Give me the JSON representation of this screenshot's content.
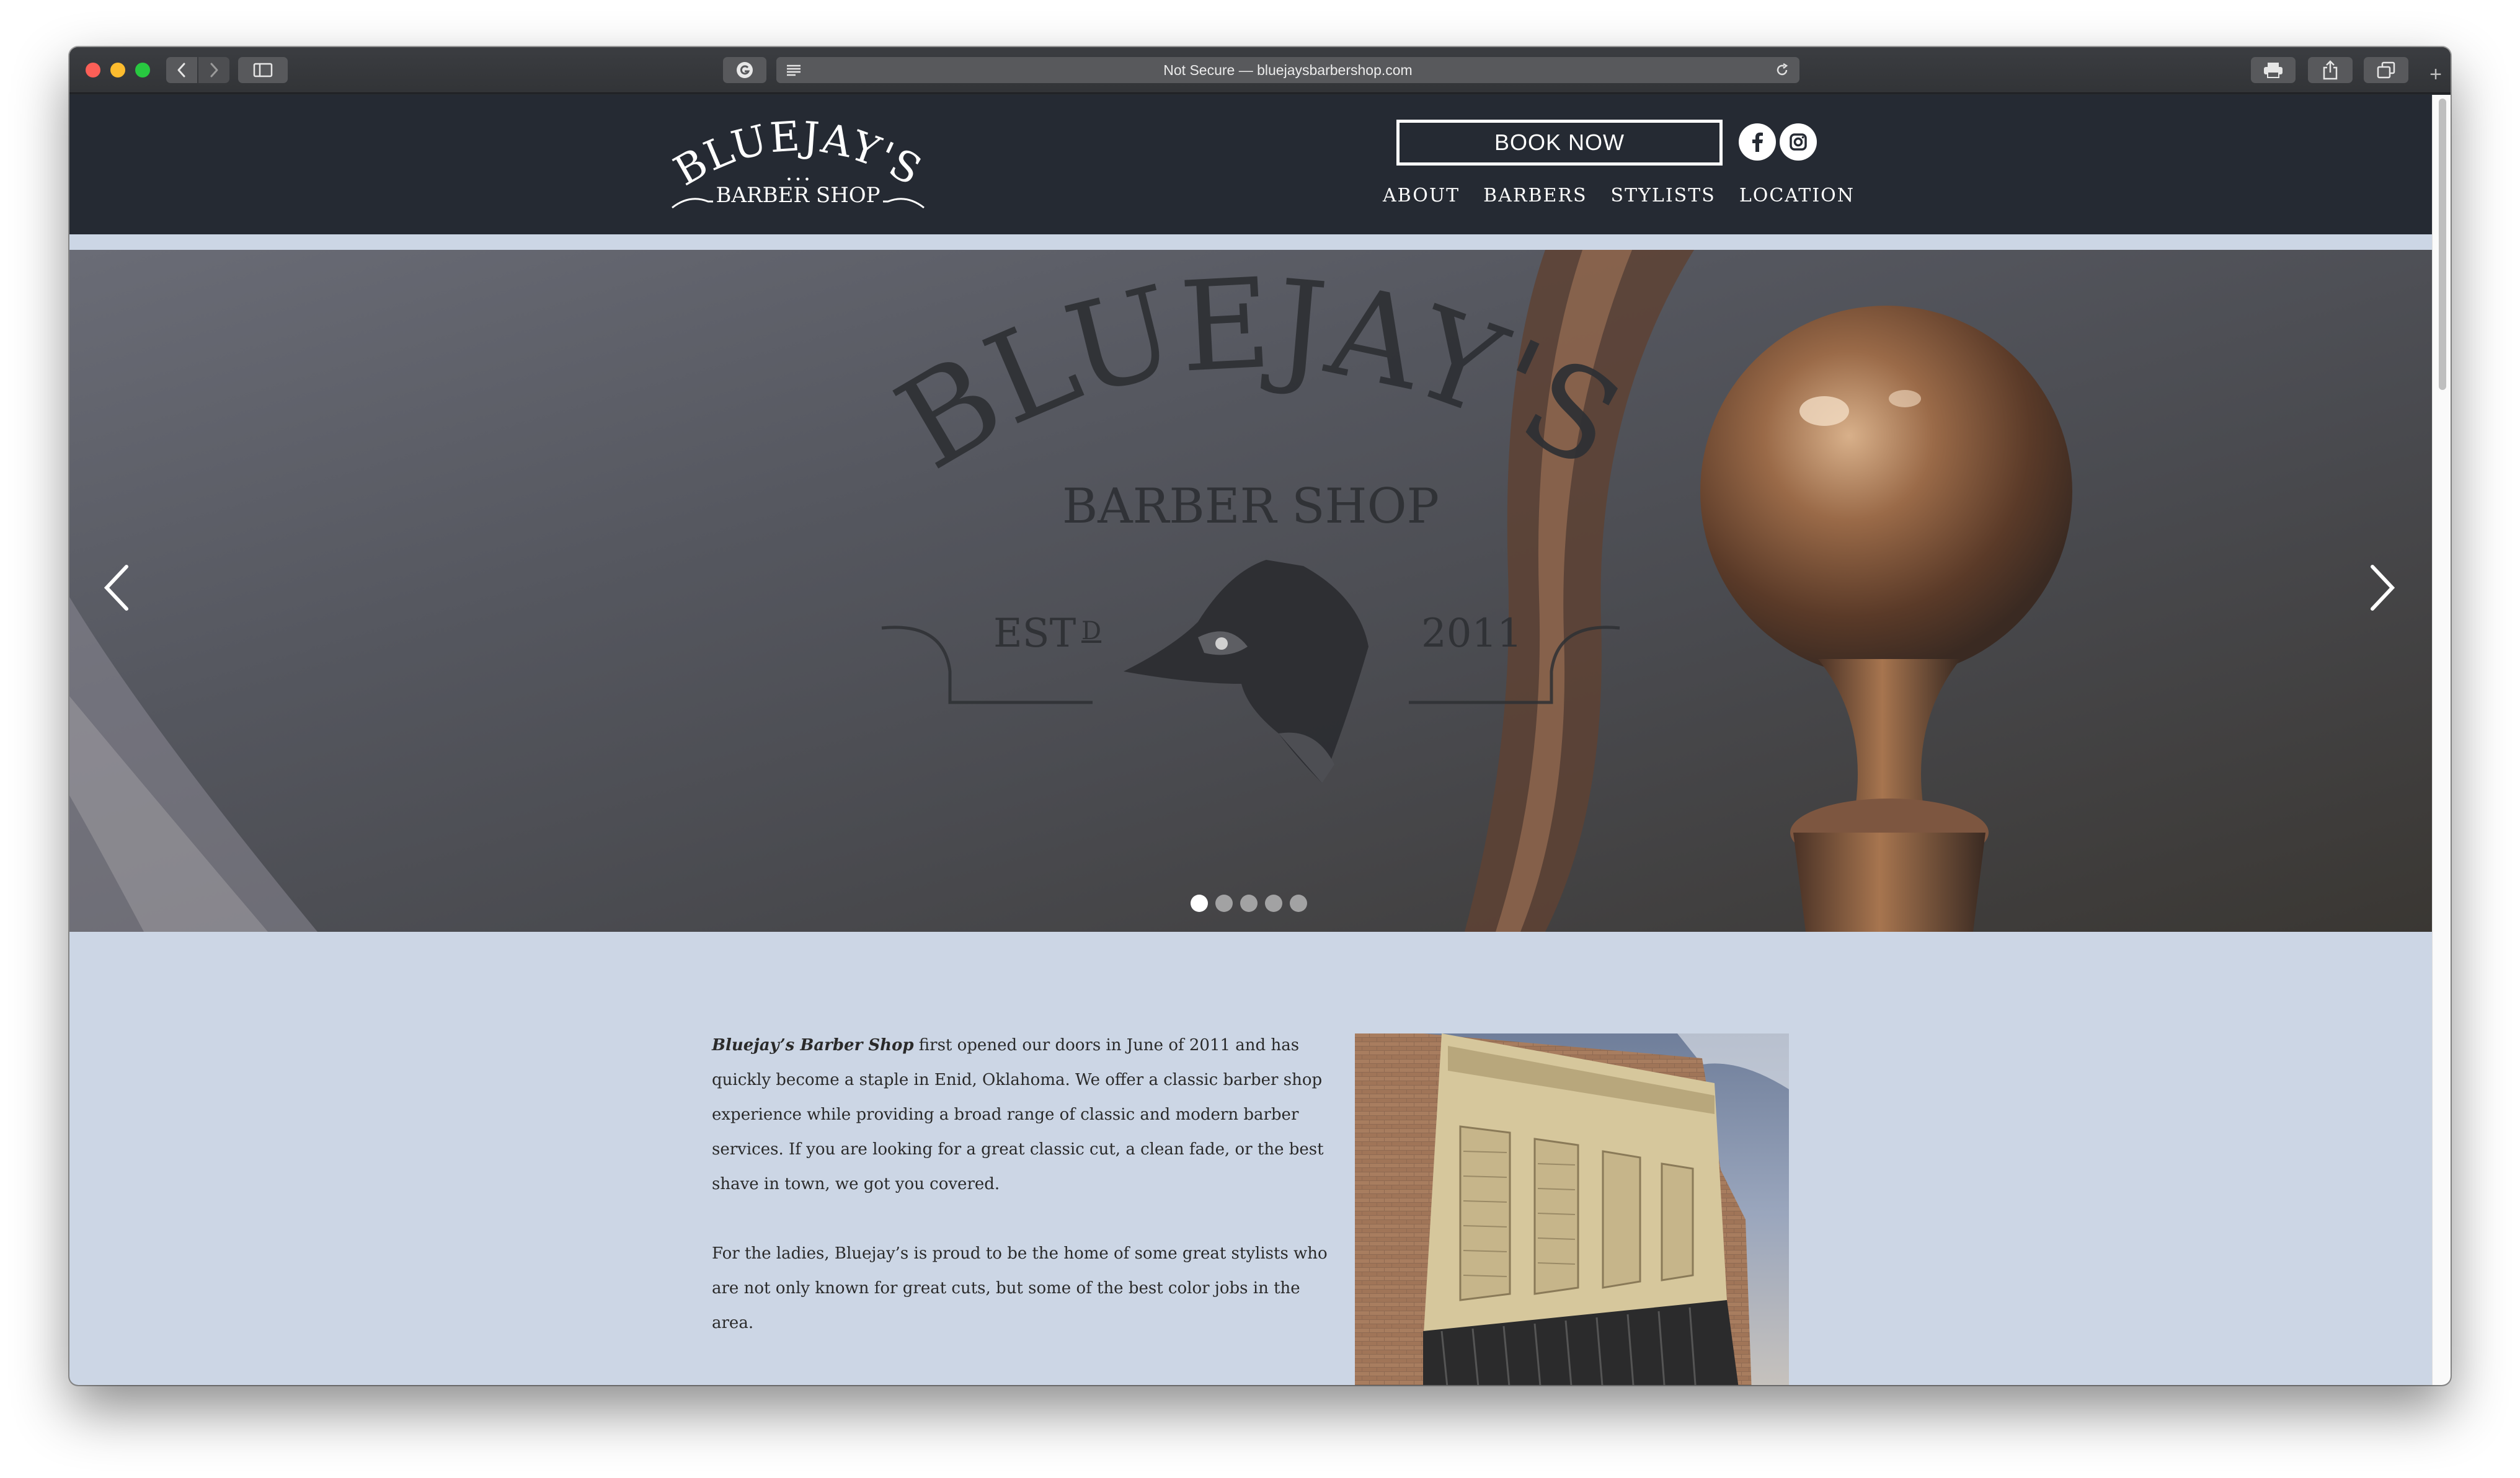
{
  "browser": {
    "address": "Not Secure — bluejaysbarbershop.com",
    "new_tab": "+"
  },
  "header": {
    "logo": {
      "name": "BLUEJAY'S",
      "sub": "BARBER SHOP",
      "dots": "• • •"
    },
    "book_now": "BOOK NOW",
    "nav": [
      "ABOUT",
      "BARBERS",
      "STYLISTS",
      "LOCATION"
    ]
  },
  "hero": {
    "logo_name": "BLUEJAY'S",
    "logo_sub": "BARBER SHOP",
    "estd": "EST",
    "estd_d": "D",
    "year": "2011",
    "slides": 5,
    "active_slide": 1
  },
  "intro": {
    "p1_em": "Bluejay’s Barber Shop",
    "p1_rest": " first opened our doors in June of 2011 and has quickly become a staple in Enid, Oklahoma. We offer a classic barber shop experience while providing a broad range of classic and modern barber services. If you are looking for a great classic cut, a clean fade, or the best shave in town, we got you covered.",
    "p2": "For the ladies, Bluejay’s is proud to be the home of some great stylists who are not only known for great cuts, but some of the best color jobs in the area."
  },
  "colors": {
    "header_bg": "#252a33",
    "page_bg": "#ccd6e5",
    "text": "#2a2a2a"
  }
}
